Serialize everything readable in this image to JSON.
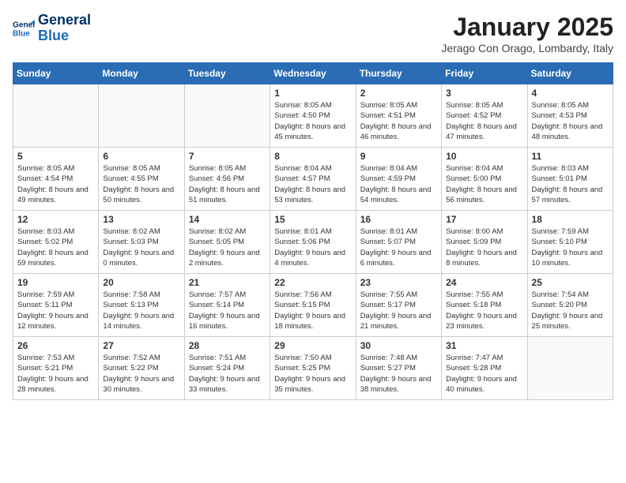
{
  "logo": {
    "line1": "General",
    "line2": "Blue"
  },
  "title": "January 2025",
  "subtitle": "Jerago Con Orago, Lombardy, Italy",
  "weekdays": [
    "Sunday",
    "Monday",
    "Tuesday",
    "Wednesday",
    "Thursday",
    "Friday",
    "Saturday"
  ],
  "weeks": [
    [
      null,
      null,
      null,
      {
        "day": "1",
        "sunrise": "8:05 AM",
        "sunset": "4:50 PM",
        "daylight": "8 hours and 45 minutes."
      },
      {
        "day": "2",
        "sunrise": "8:05 AM",
        "sunset": "4:51 PM",
        "daylight": "8 hours and 46 minutes."
      },
      {
        "day": "3",
        "sunrise": "8:05 AM",
        "sunset": "4:52 PM",
        "daylight": "8 hours and 47 minutes."
      },
      {
        "day": "4",
        "sunrise": "8:05 AM",
        "sunset": "4:53 PM",
        "daylight": "8 hours and 48 minutes."
      }
    ],
    [
      {
        "day": "5",
        "sunrise": "8:05 AM",
        "sunset": "4:54 PM",
        "daylight": "8 hours and 49 minutes."
      },
      {
        "day": "6",
        "sunrise": "8:05 AM",
        "sunset": "4:55 PM",
        "daylight": "8 hours and 50 minutes."
      },
      {
        "day": "7",
        "sunrise": "8:05 AM",
        "sunset": "4:56 PM",
        "daylight": "8 hours and 51 minutes."
      },
      {
        "day": "8",
        "sunrise": "8:04 AM",
        "sunset": "4:57 PM",
        "daylight": "8 hours and 53 minutes."
      },
      {
        "day": "9",
        "sunrise": "8:04 AM",
        "sunset": "4:59 PM",
        "daylight": "8 hours and 54 minutes."
      },
      {
        "day": "10",
        "sunrise": "8:04 AM",
        "sunset": "5:00 PM",
        "daylight": "8 hours and 56 minutes."
      },
      {
        "day": "11",
        "sunrise": "8:03 AM",
        "sunset": "5:01 PM",
        "daylight": "8 hours and 57 minutes."
      }
    ],
    [
      {
        "day": "12",
        "sunrise": "8:03 AM",
        "sunset": "5:02 PM",
        "daylight": "8 hours and 59 minutes."
      },
      {
        "day": "13",
        "sunrise": "8:02 AM",
        "sunset": "5:03 PM",
        "daylight": "9 hours and 0 minutes."
      },
      {
        "day": "14",
        "sunrise": "8:02 AM",
        "sunset": "5:05 PM",
        "daylight": "9 hours and 2 minutes."
      },
      {
        "day": "15",
        "sunrise": "8:01 AM",
        "sunset": "5:06 PM",
        "daylight": "9 hours and 4 minutes."
      },
      {
        "day": "16",
        "sunrise": "8:01 AM",
        "sunset": "5:07 PM",
        "daylight": "9 hours and 6 minutes."
      },
      {
        "day": "17",
        "sunrise": "8:00 AM",
        "sunset": "5:09 PM",
        "daylight": "9 hours and 8 minutes."
      },
      {
        "day": "18",
        "sunrise": "7:59 AM",
        "sunset": "5:10 PM",
        "daylight": "9 hours and 10 minutes."
      }
    ],
    [
      {
        "day": "19",
        "sunrise": "7:59 AM",
        "sunset": "5:11 PM",
        "daylight": "9 hours and 12 minutes."
      },
      {
        "day": "20",
        "sunrise": "7:58 AM",
        "sunset": "5:13 PM",
        "daylight": "9 hours and 14 minutes."
      },
      {
        "day": "21",
        "sunrise": "7:57 AM",
        "sunset": "5:14 PM",
        "daylight": "9 hours and 16 minutes."
      },
      {
        "day": "22",
        "sunrise": "7:56 AM",
        "sunset": "5:15 PM",
        "daylight": "9 hours and 18 minutes."
      },
      {
        "day": "23",
        "sunrise": "7:55 AM",
        "sunset": "5:17 PM",
        "daylight": "9 hours and 21 minutes."
      },
      {
        "day": "24",
        "sunrise": "7:55 AM",
        "sunset": "5:18 PM",
        "daylight": "9 hours and 23 minutes."
      },
      {
        "day": "25",
        "sunrise": "7:54 AM",
        "sunset": "5:20 PM",
        "daylight": "9 hours and 25 minutes."
      }
    ],
    [
      {
        "day": "26",
        "sunrise": "7:53 AM",
        "sunset": "5:21 PM",
        "daylight": "9 hours and 28 minutes."
      },
      {
        "day": "27",
        "sunrise": "7:52 AM",
        "sunset": "5:22 PM",
        "daylight": "9 hours and 30 minutes."
      },
      {
        "day": "28",
        "sunrise": "7:51 AM",
        "sunset": "5:24 PM",
        "daylight": "9 hours and 33 minutes."
      },
      {
        "day": "29",
        "sunrise": "7:50 AM",
        "sunset": "5:25 PM",
        "daylight": "9 hours and 35 minutes."
      },
      {
        "day": "30",
        "sunrise": "7:48 AM",
        "sunset": "5:27 PM",
        "daylight": "9 hours and 38 minutes."
      },
      {
        "day": "31",
        "sunrise": "7:47 AM",
        "sunset": "5:28 PM",
        "daylight": "9 hours and 40 minutes."
      },
      null
    ]
  ]
}
